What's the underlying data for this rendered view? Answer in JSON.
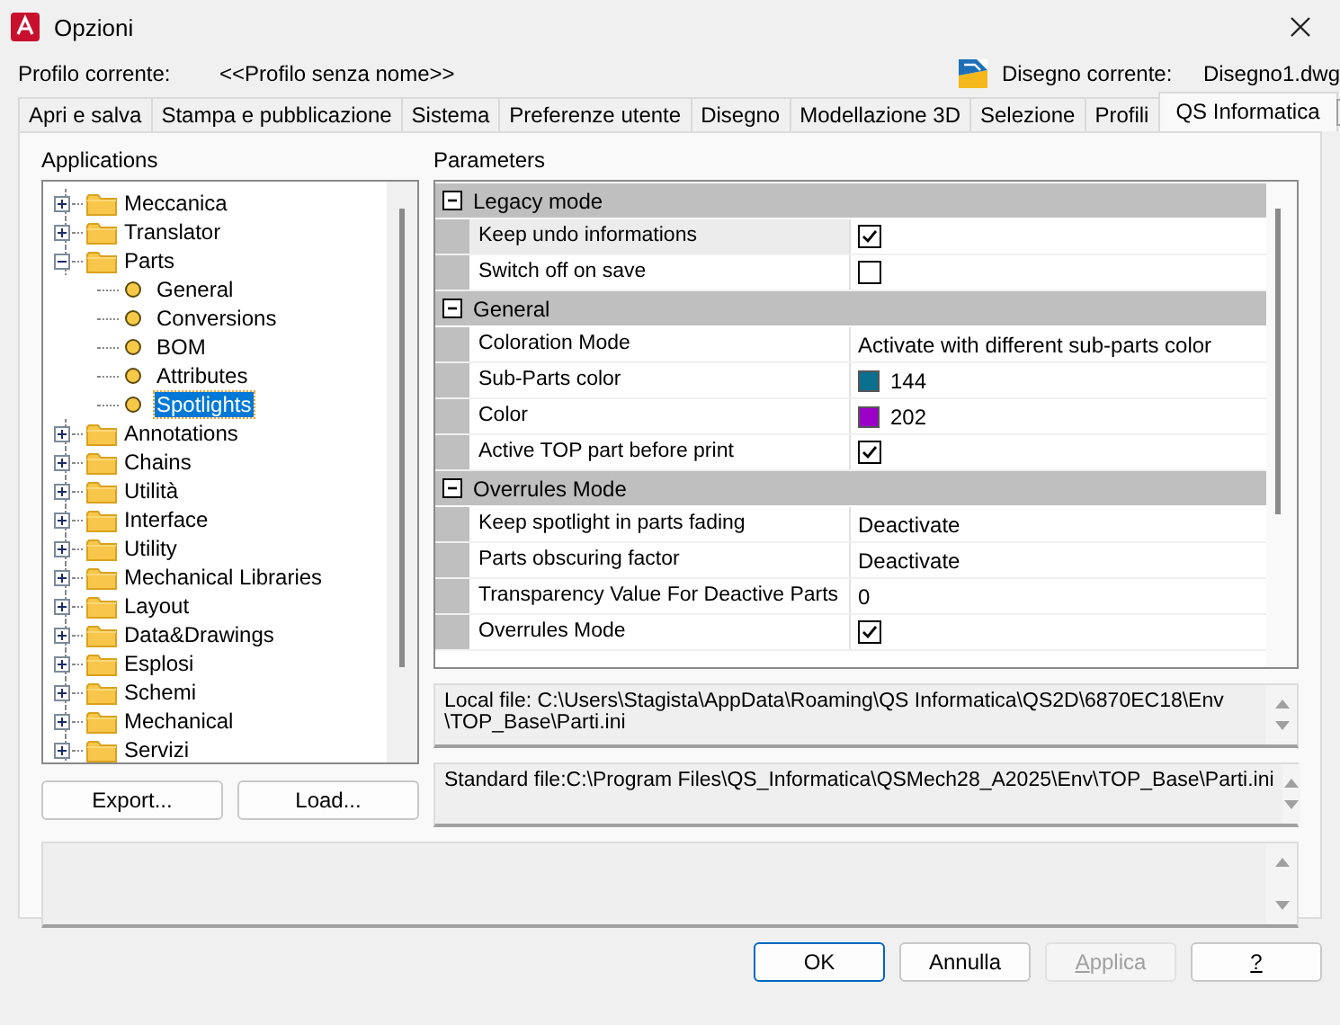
{
  "window": {
    "title": "Opzioni"
  },
  "profile": {
    "label": "Profilo corrente:",
    "value": "<<Profilo senza nome>>",
    "drawing_label": "Disegno corrente:",
    "drawing_value": "Disegno1.dwg"
  },
  "tabs": [
    {
      "label": "Apri e salva",
      "selected": false
    },
    {
      "label": "Stampa e pubblicazione",
      "selected": false
    },
    {
      "label": "Sistema",
      "selected": false
    },
    {
      "label": "Preferenze utente",
      "selected": false
    },
    {
      "label": "Disegno",
      "selected": false
    },
    {
      "label": "Modellazione 3D",
      "selected": false
    },
    {
      "label": "Selezione",
      "selected": false
    },
    {
      "label": "Profili",
      "selected": false
    },
    {
      "label": "QS Informatica",
      "selected": true
    }
  ],
  "applications": {
    "title": "Applications",
    "tree": [
      {
        "label": "Meccanica",
        "expanded": false,
        "selected": false
      },
      {
        "label": "Translator",
        "expanded": false,
        "selected": false
      },
      {
        "label": "Parts",
        "expanded": true,
        "selected": false,
        "children": [
          {
            "label": "General",
            "selected": false
          },
          {
            "label": "Conversions",
            "selected": false
          },
          {
            "label": "BOM",
            "selected": false
          },
          {
            "label": "Attributes",
            "selected": false
          },
          {
            "label": "Spotlights",
            "selected": true
          }
        ]
      },
      {
        "label": "Annotations",
        "expanded": false,
        "selected": false
      },
      {
        "label": "Chains",
        "expanded": false,
        "selected": false
      },
      {
        "label": "Utilità",
        "expanded": false,
        "selected": false
      },
      {
        "label": "Interface",
        "expanded": false,
        "selected": false
      },
      {
        "label": "Utility",
        "expanded": false,
        "selected": false
      },
      {
        "label": "Mechanical Libraries",
        "expanded": false,
        "selected": false
      },
      {
        "label": "Layout",
        "expanded": false,
        "selected": false
      },
      {
        "label": "Data&Drawings",
        "expanded": false,
        "selected": false
      },
      {
        "label": "Esplosi",
        "expanded": false,
        "selected": false
      },
      {
        "label": "Schemi",
        "expanded": false,
        "selected": false
      },
      {
        "label": "Mechanical",
        "expanded": false,
        "selected": false
      },
      {
        "label": "Servizi",
        "expanded": false,
        "selected": false
      }
    ],
    "buttons": [
      "Export...",
      "Load..."
    ]
  },
  "parameters": {
    "title": "Parameters",
    "groups": [
      {
        "label": "Legacy mode",
        "expanded": true,
        "rows": [
          {
            "kind": "checkbox",
            "name": "Keep undo informations",
            "checked": true,
            "selected": true
          },
          {
            "kind": "checkbox",
            "name": "Switch off on save",
            "checked": false,
            "selected": false
          }
        ]
      },
      {
        "label": "General",
        "expanded": true,
        "rows": [
          {
            "kind": "text",
            "name": "Coloration Mode",
            "value": "Activate with different sub-parts color",
            "selected": false
          },
          {
            "kind": "color",
            "name": "Sub-Parts color",
            "value": "144",
            "color": "#0b6f8f",
            "selected": false
          },
          {
            "kind": "color",
            "name": "Color",
            "value": "202",
            "color": "#9a00c8",
            "selected": false
          },
          {
            "kind": "checkbox",
            "name": "Active TOP part before print",
            "checked": true,
            "selected": false
          }
        ]
      },
      {
        "label": "Overrules Mode",
        "expanded": true,
        "rows": [
          {
            "kind": "text",
            "name": "Keep spotlight in parts fading",
            "value": "Deactivate",
            "selected": false
          },
          {
            "kind": "text",
            "name": "Parts obscuring factor",
            "value": "Deactivate",
            "selected": false
          },
          {
            "kind": "text",
            "name": "Transparency Value For Deactive Parts",
            "value": "0",
            "selected": false
          },
          {
            "kind": "checkbox",
            "name": "Overrules Mode",
            "checked": true,
            "selected": false
          }
        ]
      }
    ],
    "local_file": "Local file: C:\\Users\\Stagista\\AppData\\Roaming\\QS Informatica\\QS2D\\6870EC18\\Env\n\\TOP_Base\\Parti.ini",
    "standard_file": "Standard file:C:\\Program Files\\QS_Informatica\\QSMech28_A2025\\Env\\TOP_Base\\Parti.ini"
  },
  "buttons": [
    {
      "label": "OK",
      "default": true,
      "disabled": false,
      "mnemonic": false
    },
    {
      "label": "Annulla",
      "default": false,
      "disabled": false,
      "mnemonic": false
    },
    {
      "label": "Applica",
      "default": false,
      "disabled": true,
      "mnemonic": true
    },
    {
      "label": "?",
      "default": false,
      "disabled": false,
      "mnemonic": true
    }
  ]
}
